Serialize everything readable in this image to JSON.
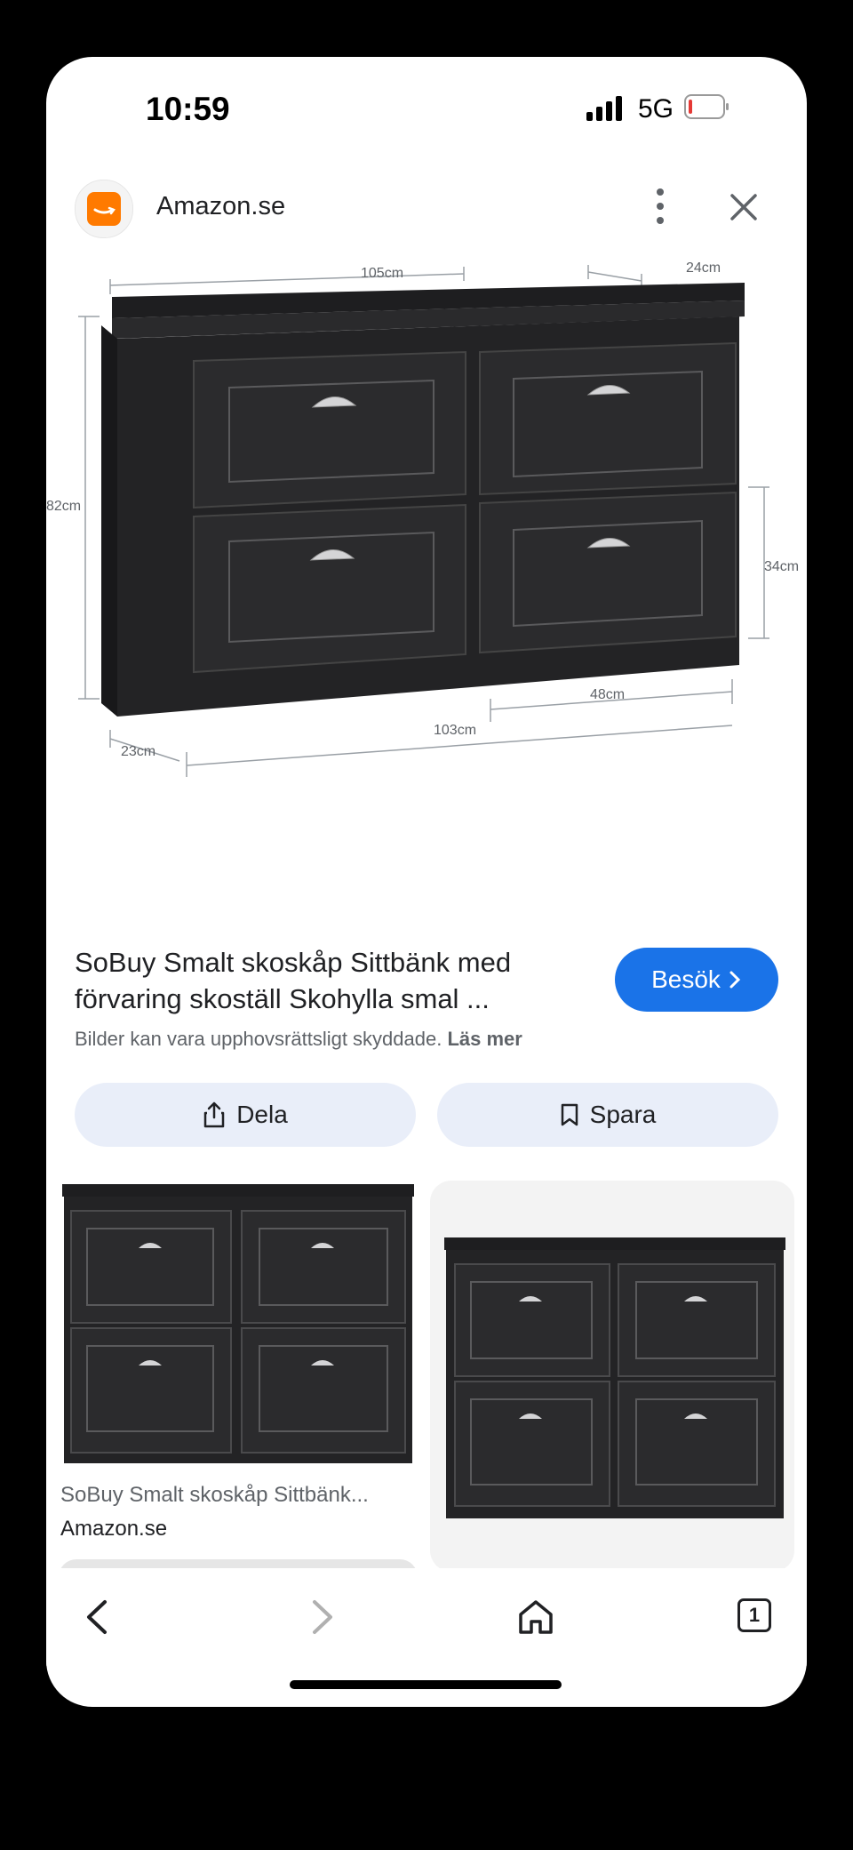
{
  "status": {
    "time": "10:59",
    "network": "5G"
  },
  "header": {
    "site": "Amazon.se",
    "menu_icon": "more-vert-icon",
    "close_icon": "close-icon"
  },
  "hero": {
    "dims": {
      "width_top": "105cm",
      "depth_top": "24cm",
      "height": "82cm",
      "drawer_height": "34cm",
      "drawer_width": "48cm",
      "width_bottom": "103cm",
      "depth_bottom": "23cm"
    }
  },
  "result": {
    "title_line1": "SoBuy Smalt skoskåp Sittbänk med",
    "title_line2": "förvaring skoställ Skohylla smal ...",
    "visit_label": "Besök",
    "notice": "Bilder kan vara upphovsrättsligt skyddade.",
    "notice_link": "Läs mer"
  },
  "actions": {
    "share_label": "Dela",
    "save_label": "Spara"
  },
  "related": [
    {
      "title": "SoBuy Smalt skoskåp Sittbänk...",
      "source": "Amazon.se"
    }
  ],
  "navbar": {
    "tabs_count": "1"
  },
  "colors": {
    "accent": "#1a73e8",
    "chip": "#e9eef9",
    "cabinet": "#232325",
    "battery_low": "#e53935"
  }
}
